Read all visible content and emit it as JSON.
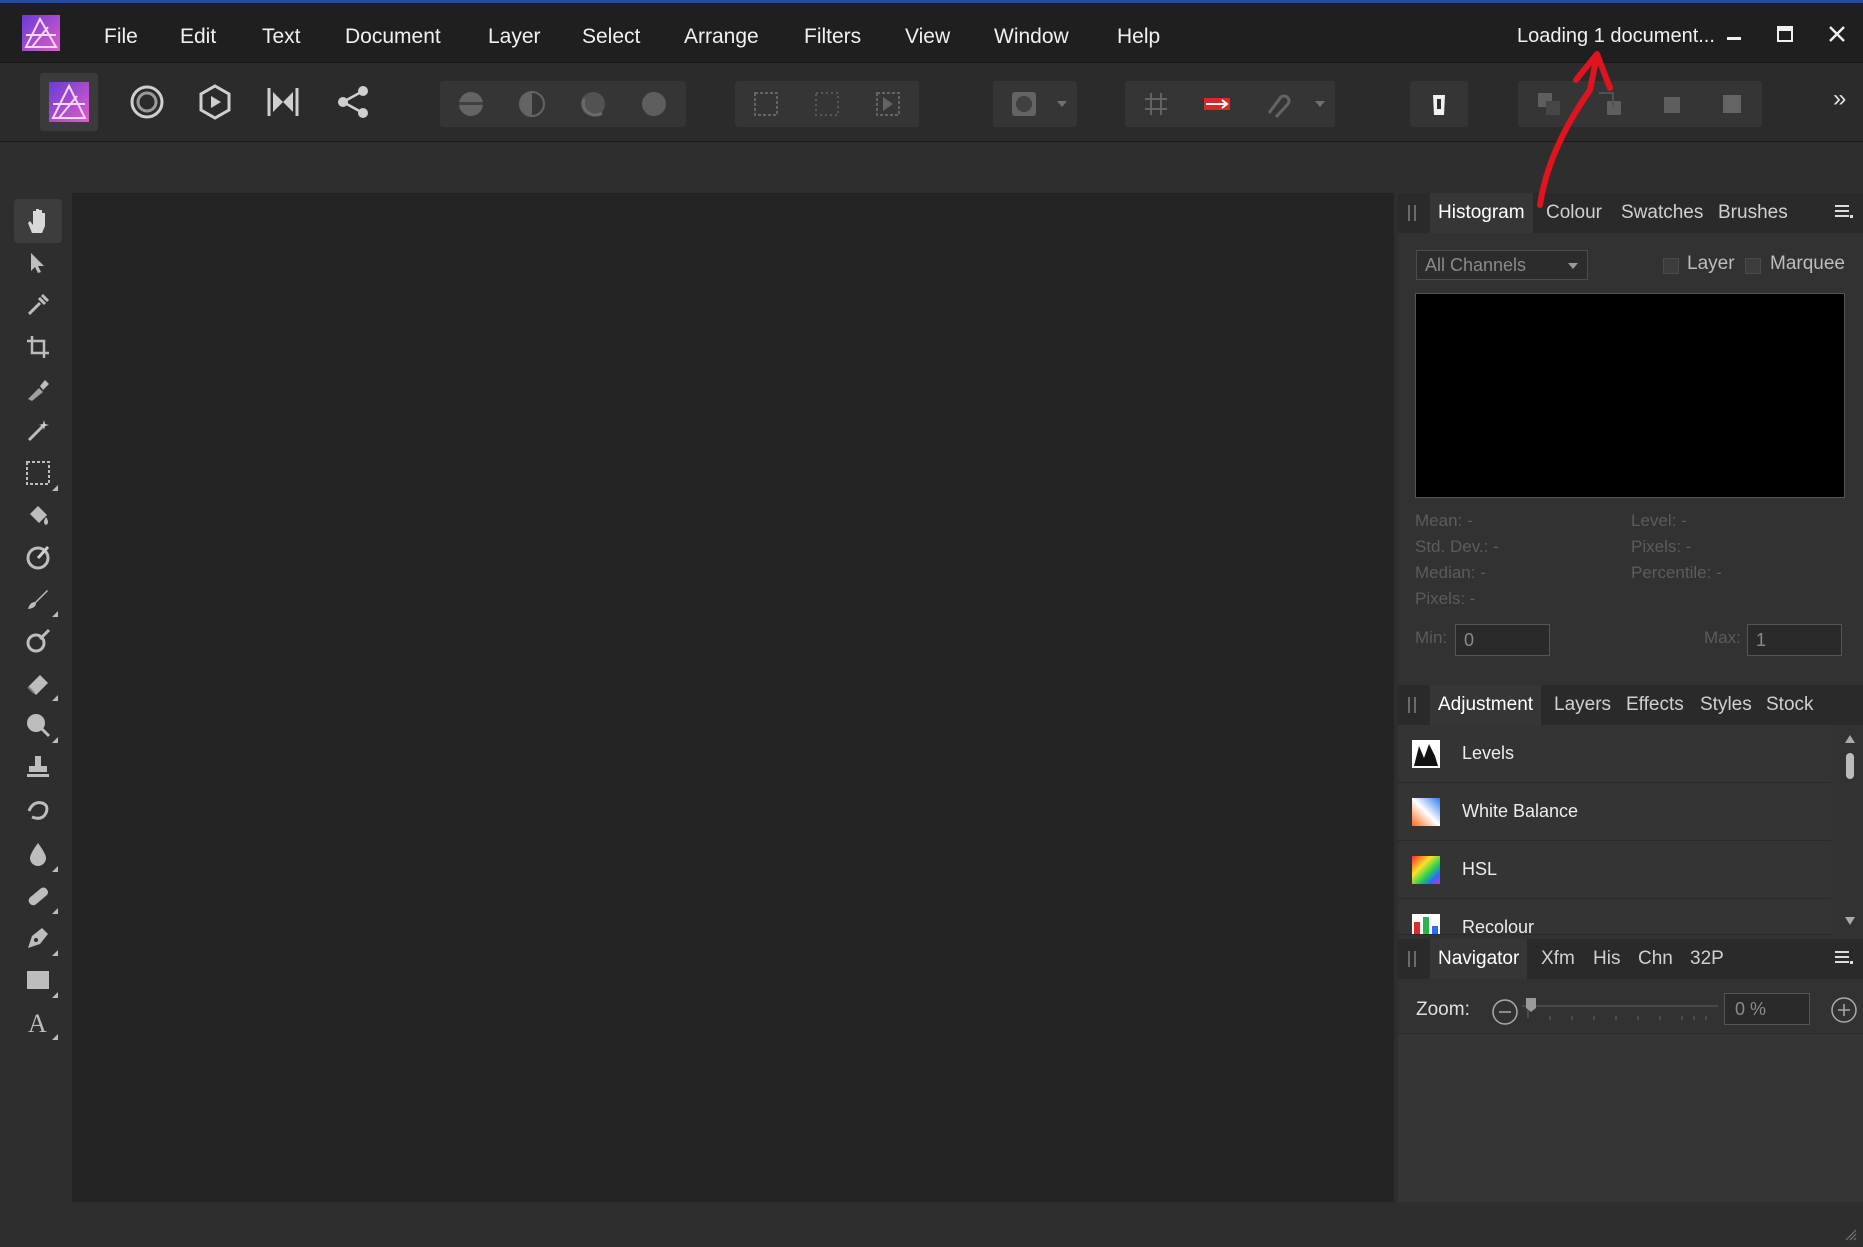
{
  "menubar": {
    "items": [
      "File",
      "Edit",
      "Text",
      "Document",
      "Layer",
      "Select",
      "Arrange",
      "Filters",
      "View",
      "Window",
      "Help"
    ],
    "status": "Loading 1 document..."
  },
  "toolbar": {
    "overflow_label": "»"
  },
  "histogram_panel": {
    "tabs": [
      "Histogram",
      "Colour",
      "Swatches",
      "Brushes"
    ],
    "channel_select": "All Channels",
    "layer_label": "Layer",
    "marquee_label": "Marquee",
    "stats_left": [
      "Mean: -",
      "Std. Dev.: -",
      "Median: -",
      "Pixels: -"
    ],
    "stats_right": [
      "Level: -",
      "Pixels: -",
      "Percentile: -"
    ],
    "min_label": "Min:",
    "min_value": "0",
    "max_label": "Max:",
    "max_value": "1"
  },
  "adjustment_panel": {
    "tabs": [
      "Adjustment",
      "Layers",
      "Effects",
      "Styles",
      "Stock"
    ],
    "items": [
      "Levels",
      "White Balance",
      "HSL",
      "Recolour"
    ]
  },
  "navigator_panel": {
    "tabs": [
      "Navigator",
      "Xfm",
      "His",
      "Chn",
      "32P"
    ],
    "zoom_label": "Zoom:",
    "zoom_value": "0 %"
  },
  "colors": {
    "accent_blue": "#1e4f9a",
    "annotation_arrow": "#e0141e",
    "logo_gradient_start": "#9b4de0",
    "logo_gradient_end": "#e05cc8"
  }
}
